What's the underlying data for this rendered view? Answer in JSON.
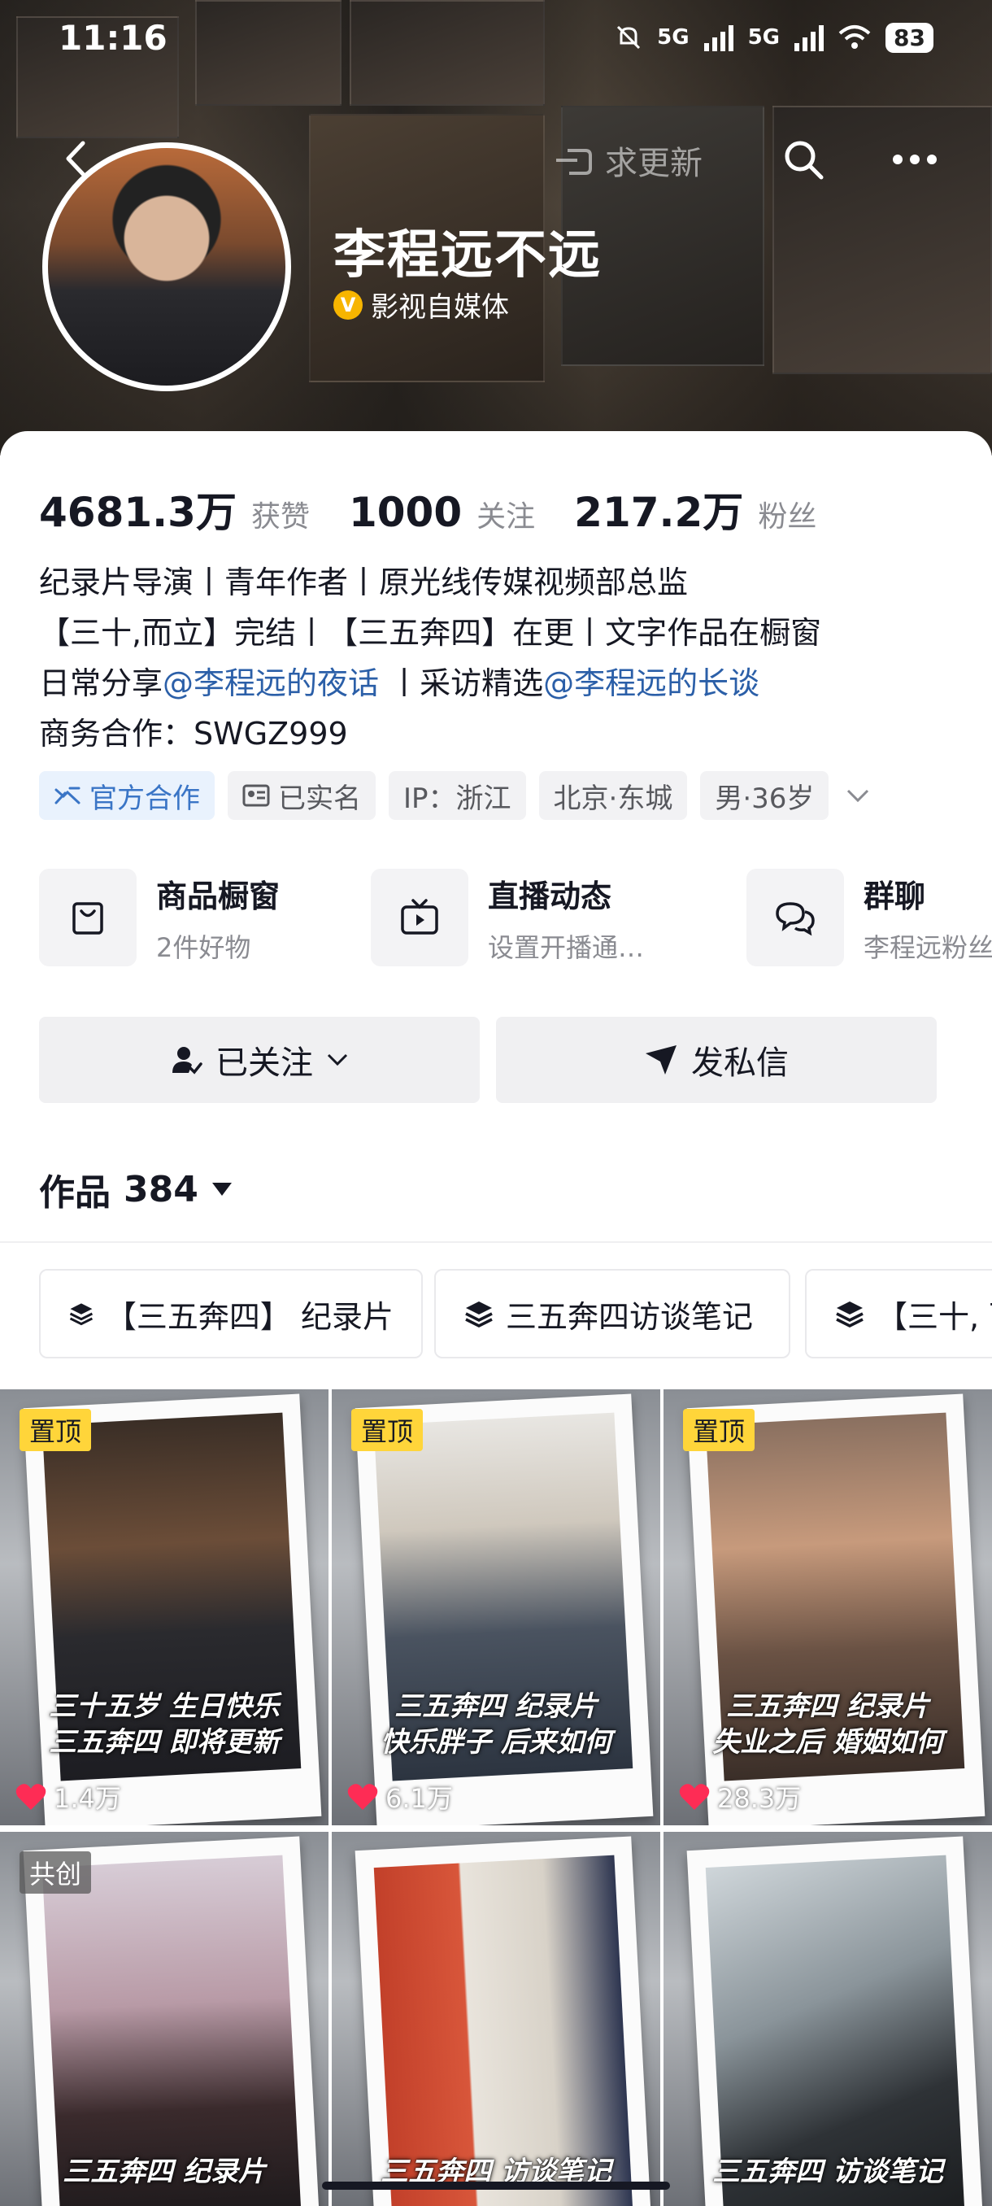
{
  "status_bar": {
    "time": "11:16",
    "net1": "5G",
    "net2": "5G",
    "battery": "83"
  },
  "nav": {
    "update_hint": "求更新"
  },
  "profile": {
    "name": "李程远不远",
    "verification": "影视自媒体",
    "verify_badge": "V"
  },
  "stats": [
    {
      "value": "4681.3万",
      "label": "获赞"
    },
    {
      "value": "1000",
      "label": "关注"
    },
    {
      "value": "217.2万",
      "label": "粉丝"
    }
  ],
  "bio": {
    "line1": "纪录片导演丨青年作者丨原光线传媒视频部总监",
    "line2": "【三十,而立】完结丨【三五奔四】在更丨文字作品在橱窗",
    "line3_a": "日常分享",
    "line3_mention1": "@李程远的夜话",
    "line3_b": " 丨采访精选",
    "line3_mention2": "@李程远的长谈",
    "line4": "商务合作：SWGZ999"
  },
  "tags": {
    "official": "官方合作",
    "realname": "已实名",
    "ip": "IP：浙江",
    "location": "北京·东城",
    "gender_age": "男·36岁"
  },
  "services": [
    {
      "title": "商品橱窗",
      "sub": "2件好物",
      "icon": "shopping-bag-icon"
    },
    {
      "title": "直播动态",
      "sub": "设置开播通…",
      "icon": "tv-icon"
    },
    {
      "title": "群聊",
      "sub": "李程远粉丝",
      "icon": "chat-bubbles-icon"
    }
  ],
  "actions": {
    "followed": "已关注",
    "message": "发私信"
  },
  "works": {
    "label": "作品",
    "count": "384"
  },
  "collections": [
    "【三五奔四】 纪录片",
    "三五奔四访谈笔记",
    "【三十, 而"
  ],
  "tiles": [
    {
      "badge": "置顶",
      "caption1": "三十五岁 生日快乐",
      "caption2": "三五奔四 即将更新",
      "likes": "1.4万"
    },
    {
      "badge": "置顶",
      "caption1": "三五奔四 纪录片",
      "caption2": "快乐胖子 后来如何",
      "likes": "6.1万"
    },
    {
      "badge": "置顶",
      "caption1": "三五奔四 纪录片",
      "caption2": "失业之后 婚姻如何",
      "likes": "28.3万"
    },
    {
      "badge": "共创",
      "caption1": "三五奔四 纪录片",
      "caption2": "",
      "likes": ""
    },
    {
      "badge": "",
      "caption1": "三五奔四 访谈笔记",
      "caption2": "",
      "likes": ""
    },
    {
      "badge": "",
      "caption1": "三五奔四 访谈笔记",
      "caption2": "",
      "likes": ""
    }
  ]
}
